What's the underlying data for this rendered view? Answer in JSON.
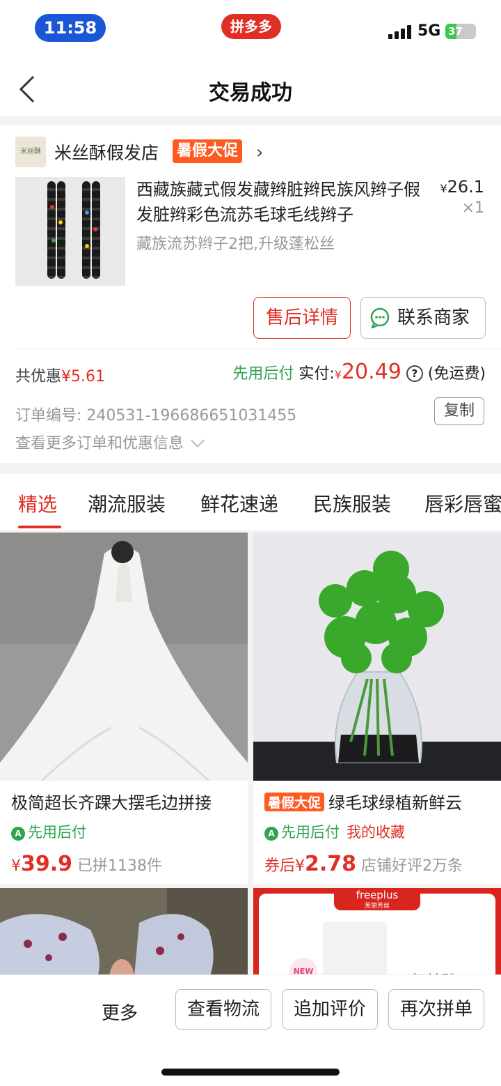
{
  "status_bar": {
    "time": "11:58",
    "app_badge": "拼多多",
    "network": "5G",
    "battery": "37",
    "battery_level": 0.37
  },
  "nav": {
    "title": "交易成功"
  },
  "order": {
    "shop_name": "米丝酥假发店",
    "shop_logo_text": "米丝酥",
    "promo_tag": "暑假大促",
    "product_title": "西藏族藏式假发藏辫脏辫民族风辫子假发脏辫彩色流苏毛球毛线辫子",
    "product_spec": "藏族流苏辫子2把,升级蓬松丝",
    "price_symbol": "¥",
    "price": "26.1",
    "quantity": "×1",
    "after_sale_button": "售后详情",
    "contact_button": "联系商家",
    "discount_label": "共优惠",
    "discount_amount": "¥5.61",
    "pay_later": "先用后付",
    "paid_label": "实付:",
    "paid_symbol": "¥",
    "paid_amount": "20.49",
    "help_icon": "?",
    "shipping_note": "(免运费)",
    "order_number_label": "订单编号:",
    "order_number": "240531-196686651031455",
    "copy_button": "复制",
    "more_info": "查看更多订单和优惠信息"
  },
  "tabs": [
    "精选",
    "潮流服装",
    "鲜花速递",
    "民族服装",
    "唇彩唇蜜"
  ],
  "feed": [
    {
      "title": "极简超长齐踝大摆毛边拼接",
      "tag": "",
      "pay_later": "先用后付",
      "favorite": "",
      "price_prefix": "",
      "price_symbol": "¥",
      "price": "39.9",
      "sales": "已拼1138件"
    },
    {
      "title": "绿毛球绿植新鲜云",
      "tag": "暑假大促",
      "pay_later": "先用后付",
      "favorite": "我的收藏",
      "price_prefix": "券后",
      "price_symbol": "¥",
      "price": "2.78",
      "sales": "店铺好评2万条"
    }
  ],
  "feed_partial": {
    "brand": "freeplus",
    "brand_sub": "芙丽芳丝",
    "new_badge": "NEW",
    "overlay_text": "氨基酸"
  },
  "bottom_bar": {
    "more": "更多",
    "logistics": "查看物流",
    "add_review": "追加评价",
    "reorder": "再次拼单"
  },
  "colors": {
    "brand_red": "#e02e24",
    "promo_orange": "#ff5a1f",
    "pay_later_green": "#2ea44f"
  }
}
